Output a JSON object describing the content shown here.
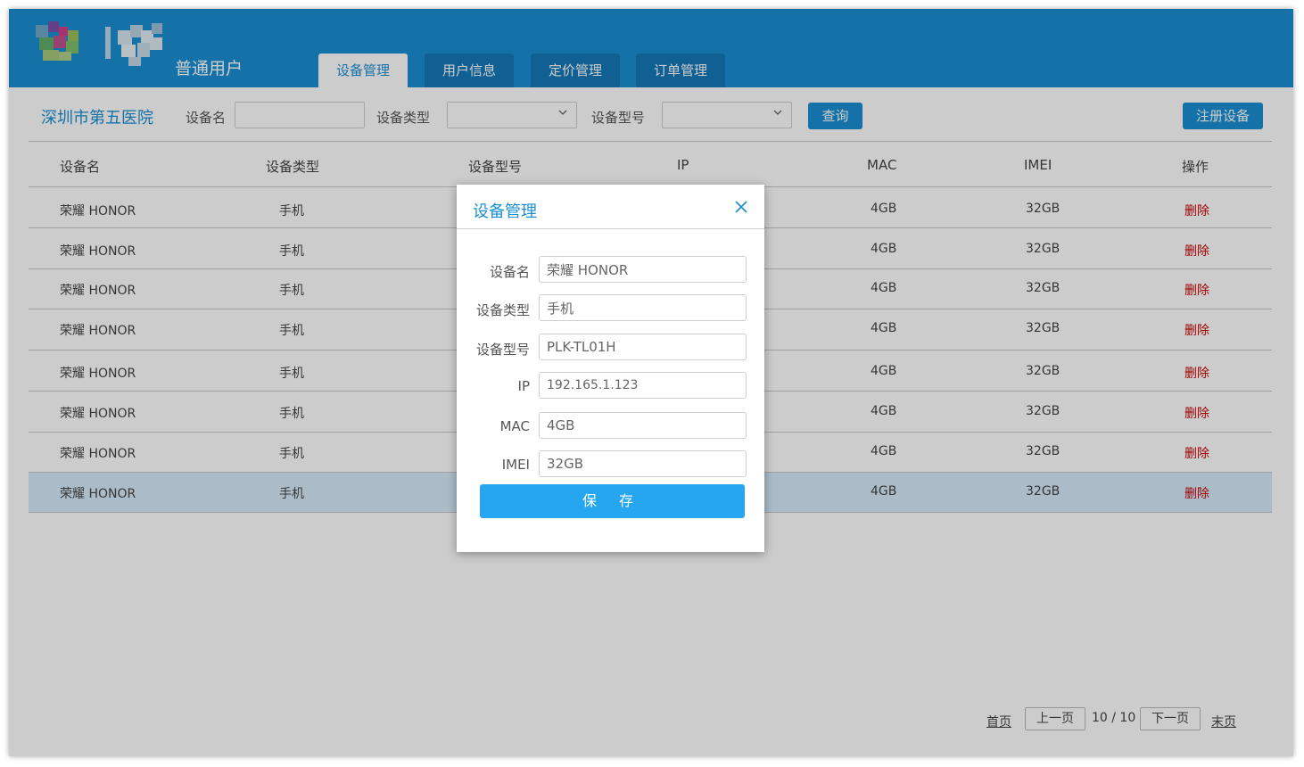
{
  "header": {
    "user_type": "普通用户",
    "tabs": [
      {
        "label": "设备管理",
        "active": true
      },
      {
        "label": "用户信息",
        "active": false
      },
      {
        "label": "定价管理",
        "active": false
      },
      {
        "label": "订单管理",
        "active": false
      }
    ]
  },
  "toolbar": {
    "hospital": "深圳市第五医院",
    "device_name_label": "设备名",
    "device_type_label": "设备类型",
    "device_model_label": "设备型号",
    "query_button": "查询",
    "register_button": "注册设备"
  },
  "table": {
    "columns": [
      "设备名",
      "设备类型",
      "设备型号",
      "IP",
      "MAC",
      "IMEI",
      "操作"
    ],
    "rows": [
      {
        "name": "荣耀 HONOR",
        "type": "手机",
        "mac": "4GB",
        "imei": "32GB",
        "action": "删除"
      },
      {
        "name": "荣耀 HONOR",
        "type": "手机",
        "mac": "4GB",
        "imei": "32GB",
        "action": "删除"
      },
      {
        "name": "荣耀 HONOR",
        "type": "手机",
        "mac": "4GB",
        "imei": "32GB",
        "action": "删除"
      },
      {
        "name": "荣耀 HONOR",
        "type": "手机",
        "mac": "4GB",
        "imei": "32GB",
        "action": "删除"
      },
      {
        "name": "荣耀 HONOR",
        "type": "手机",
        "mac": "4GB",
        "imei": "32GB",
        "action": "删除"
      },
      {
        "name": "荣耀 HONOR",
        "type": "手机",
        "mac": "4GB",
        "imei": "32GB",
        "action": "删除"
      },
      {
        "name": "荣耀 HONOR",
        "type": "手机",
        "mac": "4GB",
        "imei": "32GB",
        "action": "删除"
      },
      {
        "name": "荣耀 HONOR",
        "type": "手机",
        "mac": "4GB",
        "imei": "32GB",
        "action": "删除"
      }
    ]
  },
  "pagination": {
    "first": "首页",
    "prev": "上一页",
    "page_info": "10 / 10",
    "next": "下一页",
    "last": "末页"
  },
  "modal": {
    "title": "设备管理",
    "fields": [
      {
        "label": "设备名",
        "value": "荣耀 HONOR"
      },
      {
        "label": "设备类型",
        "value": "手机"
      },
      {
        "label": "设备型号",
        "value": "PLK-TL01H"
      },
      {
        "label": "IP",
        "value": "192.165.1.123"
      },
      {
        "label": "MAC",
        "value": "4GB"
      },
      {
        "label": "IMEI",
        "value": "32GB"
      }
    ],
    "save_button": "保 存"
  },
  "colors": {
    "header_blue": "#1a8fd3",
    "delete_red": "#cc0000",
    "save_blue": "#25a6ee"
  }
}
